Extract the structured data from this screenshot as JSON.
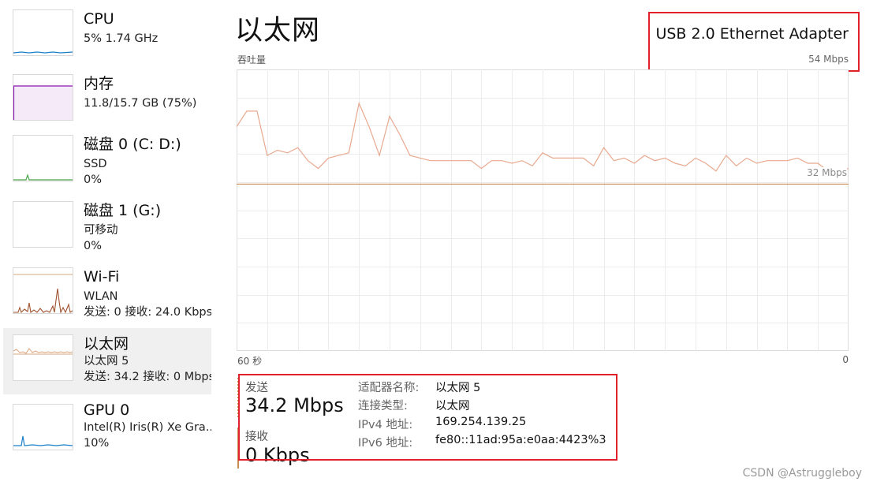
{
  "sidebar": {
    "items": [
      {
        "title": "CPU",
        "line2": "5% 1.74 GHz",
        "line3": "",
        "thumb_color": "#1a80c8",
        "icon": "cpu-graph"
      },
      {
        "title": "内存",
        "line2": "11.8/15.7 GB (75%)",
        "line3": "",
        "thumb_color": "#8b18b0",
        "icon": "memory-graph"
      },
      {
        "title": "磁盘 0 (C: D:)",
        "line2": "SSD",
        "line3": "0%",
        "thumb_color": "#4ca64c",
        "icon": "disk-graph"
      },
      {
        "title": "磁盘 1 (G:)",
        "line2": "可移动",
        "line3": "0%",
        "thumb_color": "#4ca64c",
        "icon": "disk-graph"
      },
      {
        "title": "Wi-Fi",
        "line2": "WLAN",
        "line3": "发送: 0 接收: 24.0 Kbps",
        "thumb_color": "#a0522d",
        "icon": "wifi-graph"
      },
      {
        "title": "以太网",
        "line2": "以太网 5",
        "line3": "发送: 34.2 接收: 0 Mbps",
        "thumb_color": "#a0522d",
        "icon": "ethernet-graph",
        "selected": true
      },
      {
        "title": "GPU 0",
        "line2": "Intel(R) Iris(R) Xe Gra...",
        "line3": "10%",
        "thumb_color": "#1a80c8",
        "icon": "gpu-graph"
      }
    ]
  },
  "header": {
    "title": "以太网",
    "graph_label": "吞吐量",
    "adapter_name": "USB 2.0 Ethernet Adapter",
    "adapter_speed": "54 Mbps"
  },
  "graph": {
    "scale_line_label": "32 Mbps",
    "x_left": "60 秒",
    "x_right": "0",
    "line_color": "#c98d53"
  },
  "chart_data": {
    "type": "line",
    "title": "",
    "xlabel": "",
    "ylabel": "吞吐量",
    "x_ticks": [
      "60 秒",
      "0"
    ],
    "ylim": [
      0,
      54
    ],
    "scale_reference": {
      "label": "32 Mbps",
      "value": 32
    },
    "series": [
      {
        "values": [
          43,
          46,
          46,
          37.5,
          38.5,
          38,
          39,
          36.5,
          35,
          37,
          37.5,
          38,
          47.5,
          43,
          37.5,
          45,
          41.5,
          37.5,
          37,
          36.5,
          36.5,
          36.5,
          36.5,
          36.5,
          35,
          36.5,
          36.5,
          36,
          36.5,
          35.5,
          38,
          37,
          37,
          37,
          37,
          35.5,
          39,
          36.5,
          37,
          36,
          37.5,
          36.5,
          37,
          36,
          35.5,
          37,
          36,
          34.5,
          37.5,
          35.5,
          37,
          36,
          36.5,
          36.5,
          36.5,
          37,
          36,
          36,
          34.5,
          34.5,
          35
        ]
      }
    ]
  },
  "stats": {
    "send_label": "发送",
    "send_value": "34.2 Mbps",
    "recv_label": "接收",
    "recv_value": "0 Kbps"
  },
  "properties": [
    {
      "key": "适配器名称:",
      "value": "以太网 5"
    },
    {
      "key": "连接类型:",
      "value": "以太网"
    },
    {
      "key": "IPv4 地址:",
      "value": "169.254.139.25"
    },
    {
      "key": "IPv6 地址:",
      "value": "fe80::11ad:95a:e0aa:4423%3"
    }
  ],
  "watermark": "CSDN @Astruggleboy"
}
